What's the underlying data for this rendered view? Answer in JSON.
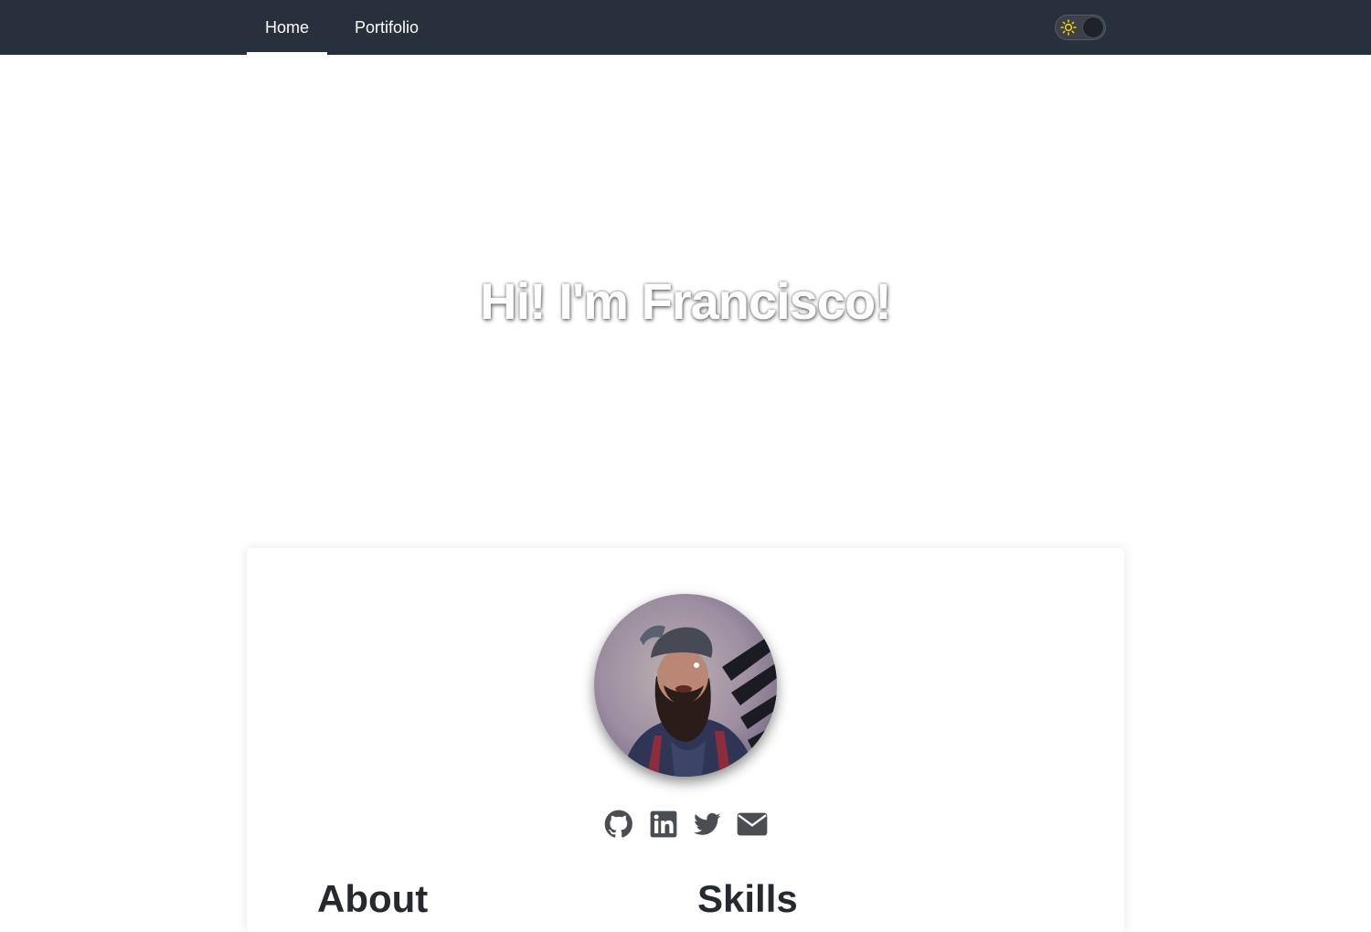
{
  "nav": {
    "tabs": [
      {
        "label": "Home",
        "active": true
      },
      {
        "label": "Portifolio",
        "active": false
      }
    ],
    "theme_toggle": {
      "icon": "sun-icon",
      "state": "light"
    }
  },
  "hero": {
    "title": "Hi! I'm Francisco!"
  },
  "profile": {
    "socials": [
      {
        "icon": "github-icon"
      },
      {
        "icon": "linkedin-icon"
      },
      {
        "icon": "twitter-icon"
      },
      {
        "icon": "email-icon"
      }
    ]
  },
  "sections": {
    "about_heading": "About",
    "skills_heading": "Skills"
  },
  "colors": {
    "navbar_bg": "#27303c",
    "icon_gray": "#4a4d52",
    "sun_yellow": "#f5d90a",
    "heading": "#252a30"
  }
}
